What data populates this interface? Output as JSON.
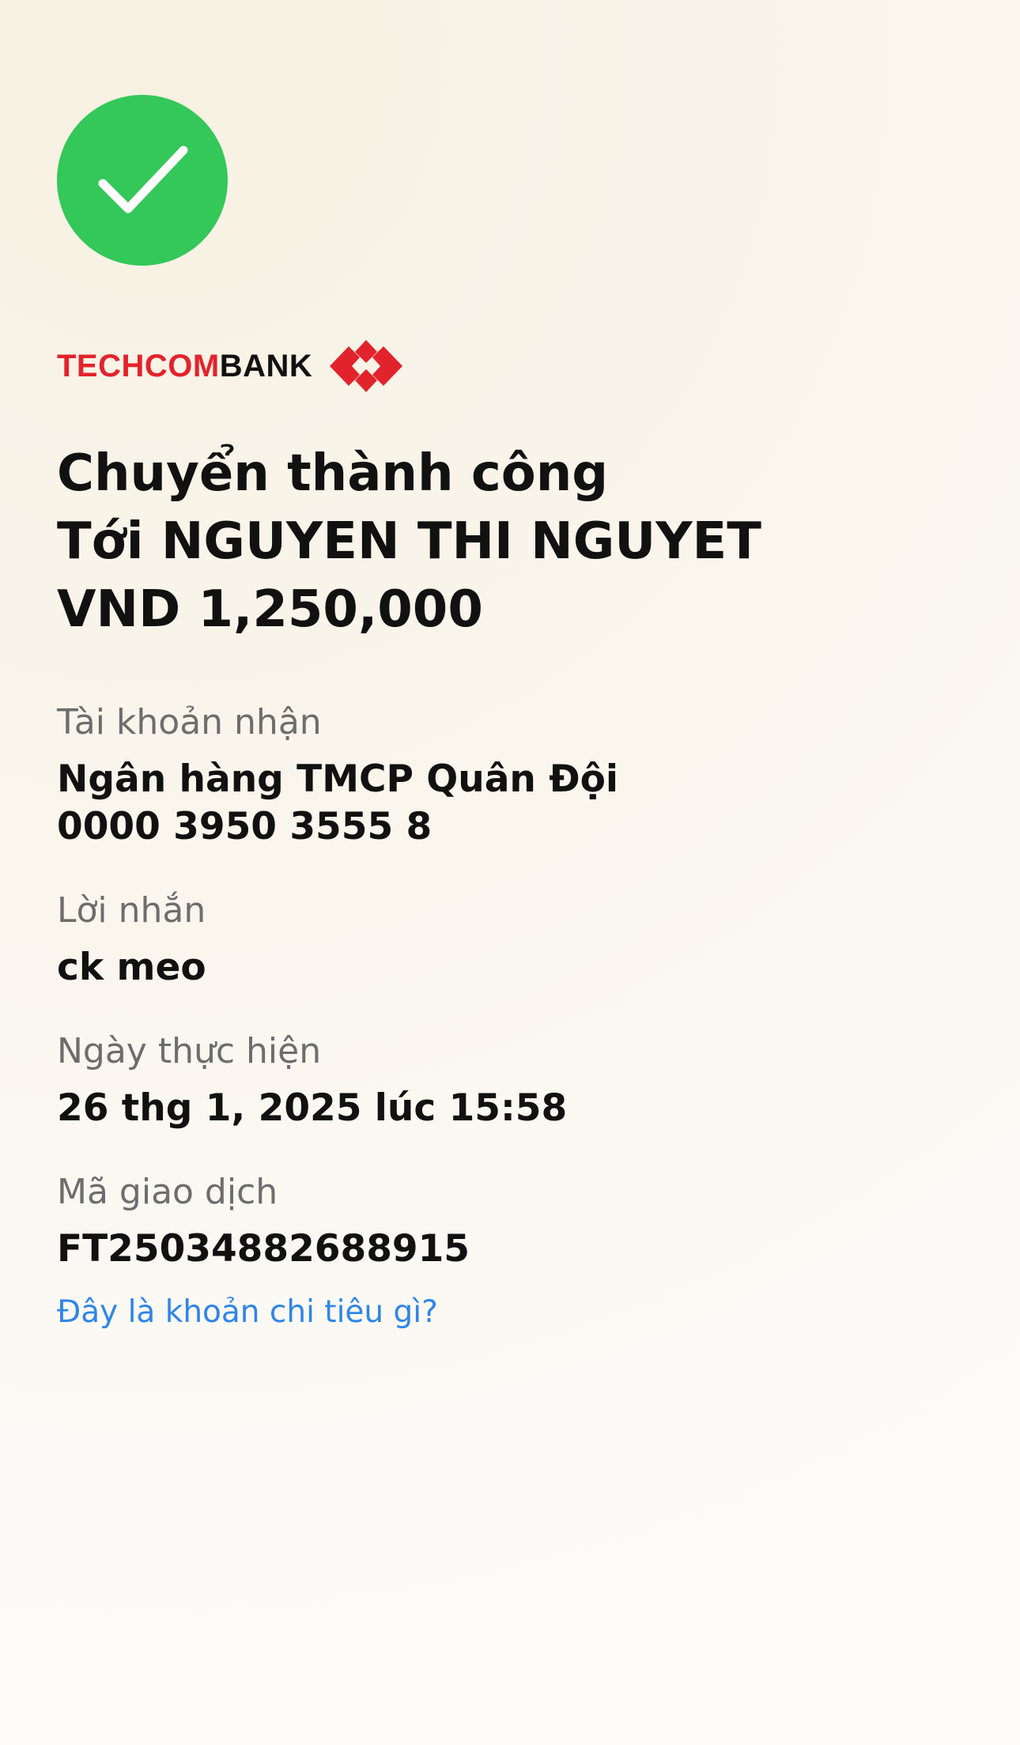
{
  "status": {
    "icon": "checkmark-icon",
    "color": "#34c759"
  },
  "brand": {
    "name_part1": "TECHCOM",
    "name_part2": "BANK",
    "logo": "techcombank-diamond-logo",
    "red": "#e3232c"
  },
  "headline": {
    "status": "Chuyển thành công",
    "recipient": "Tới NGUYEN THI NGUYET",
    "amount": "VND 1,250,000"
  },
  "details": {
    "account": {
      "label": "Tài khoản nhận",
      "bank": "Ngân hàng TMCP Quân Đội",
      "number": "0000 3950 3555 8"
    },
    "message": {
      "label": "Lời nhắn",
      "value": "ck meo"
    },
    "date": {
      "label": "Ngày thực hiện",
      "value": "26 thg 1, 2025 lúc 15:58"
    },
    "transaction": {
      "label": "Mã giao dịch",
      "value": "FT25034882688915"
    }
  },
  "link": {
    "label": "Đây là khoản chi tiêu gì?",
    "color": "#2f86e6"
  }
}
